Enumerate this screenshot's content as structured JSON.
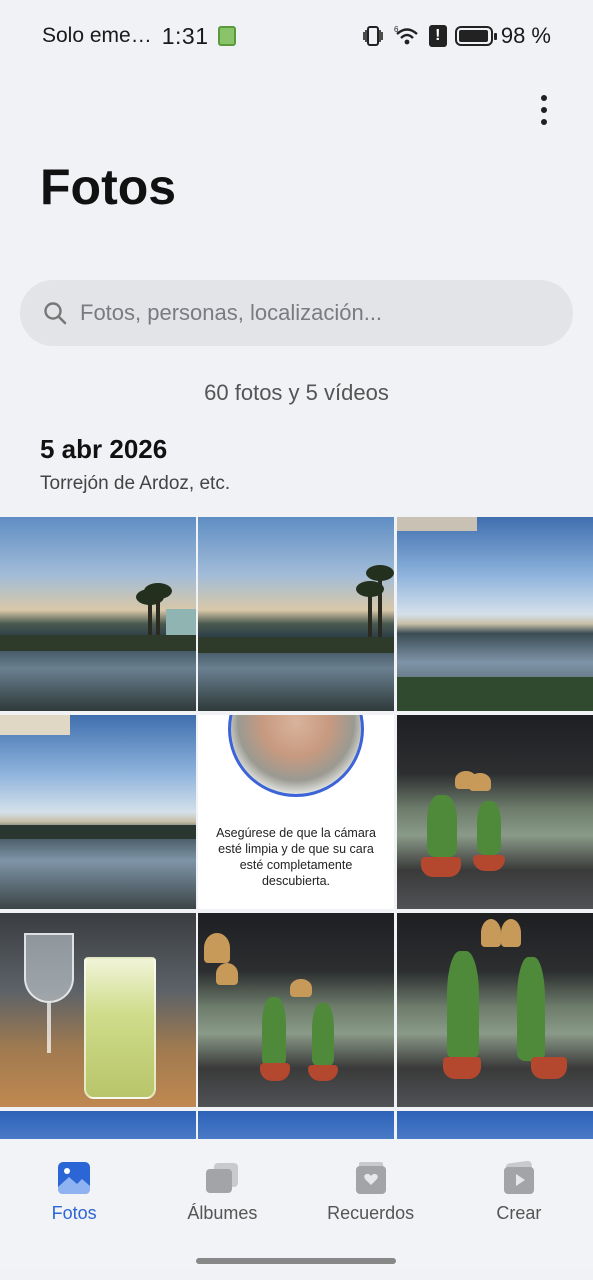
{
  "status_bar": {
    "carrier": "Solo eme…",
    "time": "1:31",
    "battery": "98 %",
    "battery_level": 0.98
  },
  "header": {
    "title": "Fotos"
  },
  "search": {
    "placeholder": "Fotos, personas, localización..."
  },
  "library": {
    "count_text": "60 fotos y 5 vídeos"
  },
  "section": {
    "date": "5 abr 2026",
    "location": "Torrejón de Ardoz, etc."
  },
  "grid": {
    "selfie_caption": "Asegúrese de que la cámara esté limpia y de que su cara esté completamente descubierta."
  },
  "nav": {
    "items": [
      {
        "label": "Fotos",
        "icon": "photos-icon",
        "active": true
      },
      {
        "label": "Álbumes",
        "icon": "albums-icon",
        "active": false
      },
      {
        "label": "Recuerdos",
        "icon": "memories-icon",
        "active": false
      },
      {
        "label": "Crear",
        "icon": "create-icon",
        "active": false
      }
    ]
  },
  "colors": {
    "accent": "#2c66d6",
    "background": "#f1f2f6",
    "search_bg": "#e3e4e8"
  }
}
